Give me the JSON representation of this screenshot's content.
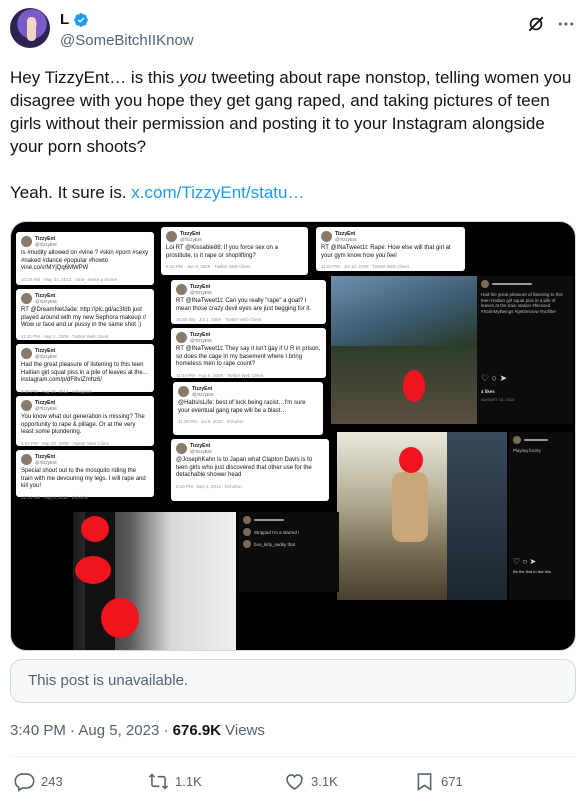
{
  "author": {
    "display_name": "L",
    "handle": "@SomeBitchIIKnow"
  },
  "tweet": {
    "text_line1_a": "Hey TizzyEnt… is this ",
    "text_line1_em": "you",
    "text_line1_b": " tweeting about rape nonstop, telling women you disagree with you hope they get gang raped, and taking pictures of teen girls without their permission and posting it to your Instagram alongside your porn shoots?",
    "text_line2": "Yeah. It sure is. ",
    "link": "x.com/TizzyEnt/statu…"
  },
  "media": {
    "cards": [
      {
        "name": "TizzyEnt",
        "sub": "@TizzyEnt",
        "text": "Is #nudity allowed on #vine ? #skin #porn #sexy #naked #dance #popular #howto vine.co/v/MYjQq6MWPW",
        "meta": "10:34 AM · May 31, 2013 · Vine - Make a Scene"
      },
      {
        "name": "TizzyEnt",
        "sub": "@TizzyEnt",
        "text": "Lol RT @Kissable88: If you force sex on a prostitute, is it rape or shoplifting?",
        "meta": "8:18 PM · Jan 8, 2009 · Twitter Web Client"
      },
      {
        "name": "TizzyEnt",
        "sub": "@TizzyEnt",
        "text": "RT @INaTweet1t: Rape: How else will that girl at your gym know how you feel",
        "meta": "11:04 PM · Jul 10, 2009 · Twitter Web Client"
      },
      {
        "name": "TizzyEnt",
        "sub": "@TizzyEnt",
        "text": "RT @DreamNetJade: http://pic.gd/ac3fdb just played around with my new Sephora makeup // Wow ur face and ur pussy in the same shot :)",
        "meta": "11:31 PM · Sep 1, 2009 · Twitter Web Client"
      },
      {
        "name": "TizzyEnt",
        "sub": "@TizzyEnt",
        "text": "RT @INaTweet1t: Can you really \"rape\" a goat? I mean those crazy devil eyes are just begging for it.",
        "meta": "10:40 AM · Jul 1, 2009 · Twitter Web Client"
      },
      {
        "name": "TizzyEnt",
        "sub": "@TizzyEnt",
        "text": "Had the great pleasure of listening to this teen Haitian girl squat piss in a pile of leaves at the… instagram.com/p/dF8vIZmhz6/",
        "meta": "9:49 PM · Aug 15, 2013 · Instagram"
      },
      {
        "name": "TizzyEnt",
        "sub": "@TizzyEnt",
        "text": "RT @INaTweet1t: They say it isn't gay if U R in prison, so does the cage in my basement where I bring homeless men to rape count?",
        "meta": "11:44 PM · Aug 5, 2009 · Twitter Web Client"
      },
      {
        "name": "TizzyEnt",
        "sub": "@TizzyEnt",
        "text": "You know what our generation is missing? The opportunity to rape & pillage. Or at the very least some plundering.",
        "meta": "1:02 PM · Sep 20, 2009 · Twitter Web Client"
      },
      {
        "name": "TizzyEnt",
        "sub": "@TizzyEnt",
        "text": "@HabsIsLife: best of luck being racist…I'm sure your eventual gang rape will be a blast…",
        "meta": "11:38 PM · Jul 6, 2010 · Echofon"
      },
      {
        "name": "TizzyEnt",
        "sub": "@TizzyEnt",
        "text": "Special shout out to the mosquito riding the train with me devouring my legs. I will rape and kill you!",
        "meta": "12:14 AM · Aug 5, 2011 · Echofon"
      },
      {
        "name": "TizzyEnt",
        "sub": "@TizzyEnt",
        "text": "@JosephKahn is to Japan what Clapton Davis is to teen girls who just discovered that other use for the detachable shower head",
        "meta": "6:10 PM · Sep 2, 2012 · Echofon"
      }
    ],
    "ig1_caption": "Had the great pleasure of listening to this teen Haitian girl squat piss in a pile of leaves at the train station #blessed #StoleMyBeings #gettinsnow #nofilter",
    "ig1_likes": "4 likes",
    "ig1_date": "AUGUST 15, 2013",
    "ig2_caption": "Playing hooky",
    "ig3_comment1": "Stripped I'm a starred !",
    "ig3_comment2": "boo_kitty_sadky that",
    "ig2_footer": "Be the first to like this"
  },
  "unavailable": "This post is unavailable.",
  "meta": {
    "time": "3:40 PM",
    "sep1": " · ",
    "date": "Aug 5, 2023",
    "sep2": " · ",
    "views_count": "676.9K",
    "views_label": " Views"
  },
  "actions": {
    "replies": "243",
    "reposts": "1.1K",
    "likes": "3.1K",
    "bookmarks": "671"
  },
  "colors": {
    "accent": "#1d9bf0",
    "muted": "#536471",
    "redaction": "#f0141e"
  }
}
